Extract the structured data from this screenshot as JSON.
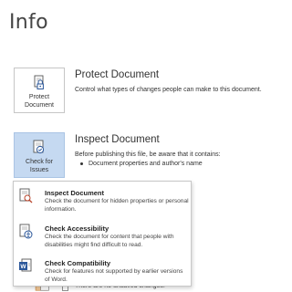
{
  "page": {
    "title": "Info"
  },
  "protect": {
    "button_label": "Protect Document",
    "title": "Protect Document",
    "description": "Control what types of changes people can make to this document."
  },
  "inspect": {
    "button_label": "Check for Issues",
    "title": "Inspect Document",
    "description": "Before publishing this file, be aware that it contains:",
    "bullets": [
      "Document properties and author's name"
    ]
  },
  "menu": {
    "items": [
      {
        "title": "Inspect Document",
        "description": "Check the document for hidden properties or personal information.",
        "icon": "inspect-document-icon"
      },
      {
        "title": "Check Accessibility",
        "description": "Check the document for content that people with disabilities might find difficult to read.",
        "icon": "accessibility-icon"
      },
      {
        "title": "Check Compatibility",
        "description": "Check for features not supported by earlier versions of Word.",
        "icon": "compatibility-icon"
      }
    ]
  },
  "below": {
    "text": "There are no unsaved changes."
  },
  "colors": {
    "accent": "#2b579a",
    "active_button": "#c5d9f1",
    "border": "#c6c6c6"
  }
}
